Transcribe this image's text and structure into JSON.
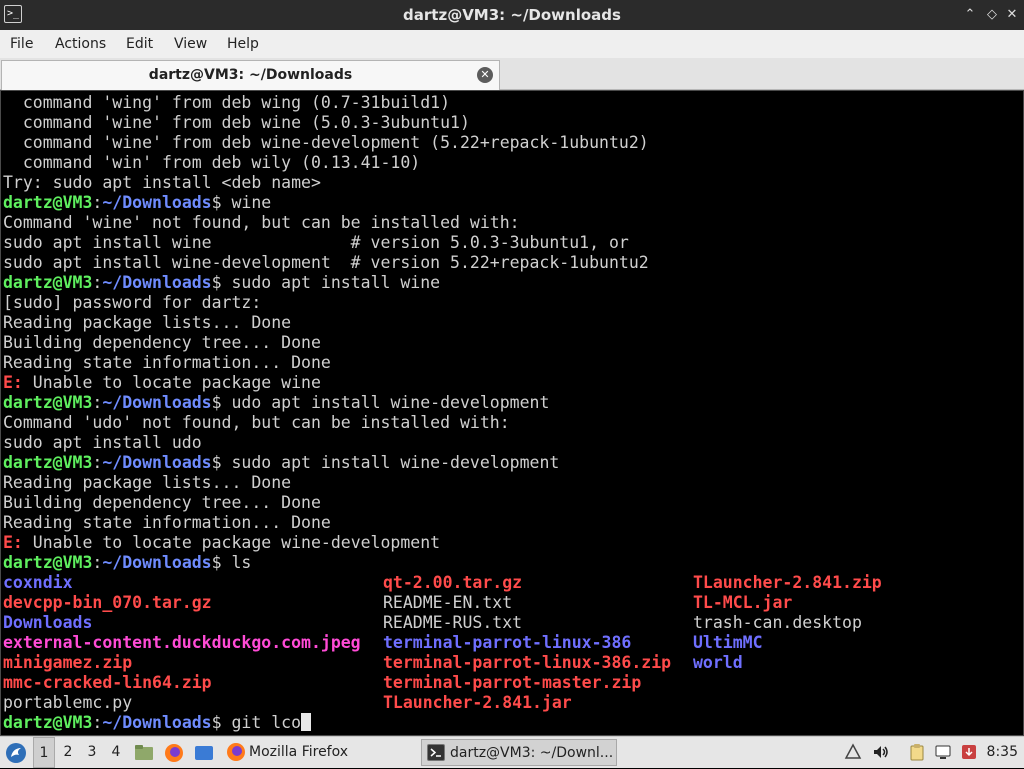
{
  "window": {
    "title": "dartz@VM3: ~/Downloads",
    "app_icon_glyph": ">_",
    "minimize_glyph": "⌃",
    "maximize_glyph": "◇",
    "close_glyph": "✕"
  },
  "menu": [
    "File",
    "Actions",
    "Edit",
    "View",
    "Help"
  ],
  "tab": {
    "label": "dartz@VM3: ~/Downloads",
    "close_glyph": "✕"
  },
  "terminal": {
    "prompt_user": "dartz@VM3",
    "prompt_sep": ":",
    "prompt_path": "~/Downloads",
    "prompt_dollar": "$ ",
    "lines": [
      {
        "kind": "text",
        "text": "  command 'wing' from deb wing (0.7-31build1)"
      },
      {
        "kind": "text",
        "text": "  command 'wine' from deb wine (5.0.3-3ubuntu1)"
      },
      {
        "kind": "text",
        "text": "  command 'wine' from deb wine-development (5.22+repack-1ubuntu2)"
      },
      {
        "kind": "text",
        "text": "  command 'win' from deb wily (0.13.41-10)"
      },
      {
        "kind": "text",
        "text": "Try: sudo apt install <deb name>"
      },
      {
        "kind": "prompt",
        "cmd": "wine"
      },
      {
        "kind": "text",
        "text": "Command 'wine' not found, but can be installed with:"
      },
      {
        "kind": "text",
        "text": "sudo apt install wine              # version 5.0.3-3ubuntu1, or"
      },
      {
        "kind": "text",
        "text": "sudo apt install wine-development  # version 5.22+repack-1ubuntu2"
      },
      {
        "kind": "prompt",
        "cmd": "sudo apt install wine"
      },
      {
        "kind": "text",
        "text": "[sudo] password for dartz:"
      },
      {
        "kind": "text",
        "text": "Reading package lists... Done"
      },
      {
        "kind": "text",
        "text": "Building dependency tree... Done"
      },
      {
        "kind": "text",
        "text": "Reading state information... Done"
      },
      {
        "kind": "error",
        "prefix": "E:",
        "text": " Unable to locate package wine"
      },
      {
        "kind": "prompt",
        "cmd": "udo apt install wine-development"
      },
      {
        "kind": "text",
        "text": "Command 'udo' not found, but can be installed with:"
      },
      {
        "kind": "text",
        "text": "sudo apt install udo"
      },
      {
        "kind": "prompt",
        "cmd": "sudo apt install wine-development"
      },
      {
        "kind": "text",
        "text": "Reading package lists... Done"
      },
      {
        "kind": "text",
        "text": "Building dependency tree... Done"
      },
      {
        "kind": "text",
        "text": "Reading state information... Done"
      },
      {
        "kind": "error",
        "prefix": "E:",
        "text": " Unable to locate package wine-development"
      },
      {
        "kind": "prompt",
        "cmd": "ls"
      }
    ],
    "ls_columns": [
      [
        {
          "name": "coxndix",
          "type": "dir"
        },
        {
          "name": "devcpp-bin_070.tar.gz",
          "type": "archive"
        },
        {
          "name": "Downloads",
          "type": "dir"
        },
        {
          "name": "external-content.duckduckgo.com.jpeg",
          "type": "image"
        },
        {
          "name": "minigamez.zip",
          "type": "archive"
        },
        {
          "name": "mmc-cracked-lin64.zip",
          "type": "archive"
        },
        {
          "name": "portablemc.py",
          "type": "plain"
        }
      ],
      [
        {
          "name": "qt-2.00.tar.gz",
          "type": "archive"
        },
        {
          "name": "README-EN.txt",
          "type": "plain"
        },
        {
          "name": "README-RUS.txt",
          "type": "plain"
        },
        {
          "name": "terminal-parrot-linux-386",
          "type": "dir"
        },
        {
          "name": "terminal-parrot-linux-386.zip",
          "type": "archive"
        },
        {
          "name": "terminal-parrot-master.zip",
          "type": "archive"
        },
        {
          "name": "TLauncher-2.841.jar",
          "type": "archive"
        }
      ],
      [
        {
          "name": "TLauncher-2.841.zip",
          "type": "archive"
        },
        {
          "name": "TL-MCL.jar",
          "type": "archive"
        },
        {
          "name": "trash-can.desktop",
          "type": "plain"
        },
        {
          "name": "UltimMC",
          "type": "dir"
        },
        {
          "name": "world",
          "type": "dir"
        }
      ]
    ],
    "current_input": "git lco"
  },
  "taskbar": {
    "workspaces": [
      "1",
      "2",
      "3",
      "4"
    ],
    "active_workspace": "1",
    "tasks": [
      {
        "label": "Mozilla Firefox",
        "icon": "firefox-icon",
        "active": false
      },
      {
        "label": "dartz@VM3: ~/Downl...",
        "icon": "terminal-icon",
        "active": true
      }
    ],
    "clock": "8:35"
  },
  "colors": {
    "prompt_user": "#5ff05f",
    "prompt_path": "#6f8cff",
    "error": "#ff4b4b",
    "archive": "#ff4b4b",
    "directory": "#6f6fff",
    "image": "#ff4bd6"
  }
}
